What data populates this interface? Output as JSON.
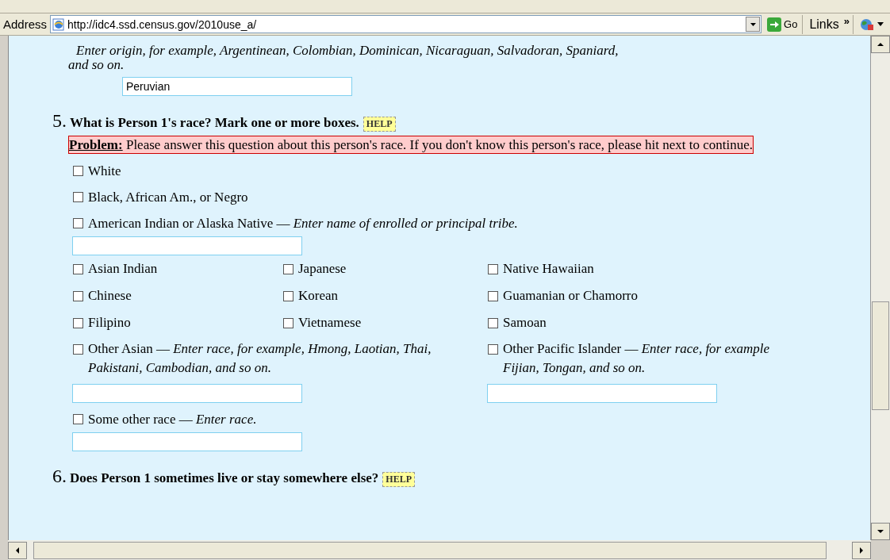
{
  "address_bar": {
    "label": "Address",
    "url": "http://idc4.ssd.census.gov/2010use_a/",
    "go": "Go",
    "links": "Links",
    "links_chevron": "»"
  },
  "origin": {
    "hint": "Enter origin, for example, Argentinean, Colombian, Dominican, Nicaraguan, Salvadoran, Spaniard,",
    "hint_end": "and so on.",
    "value": "Peruvian"
  },
  "question_5": {
    "number": "5.",
    "text": "What is Person 1's race? Mark one or more boxes.",
    "help": "HELP",
    "problem": {
      "label": "Problem:",
      "text": " Please answer this question about this person's race. If you don't know this person's race, please hit next to continue."
    }
  },
  "options": [
    {
      "kind": "plain",
      "label": "White",
      "checked": false
    },
    {
      "kind": "plain",
      "label": "Black, African Am., or Negro",
      "checked": false
    },
    {
      "kind": "write_in",
      "label": "American Indian or Alaska Native — *Enter name of enrolled or principal tribe.*",
      "checked": false
    }
  ],
  "grid": [
    {
      "label": "Asian Indian",
      "checked": false
    },
    {
      "label": "Japanese",
      "checked": false
    },
    {
      "label": "Native Hawaiian",
      "checked": false
    },
    {
      "label": "Chinese",
      "checked": false
    },
    {
      "label": "Korean",
      "checked": false
    },
    {
      "label": "Guamanian or Chamorro",
      "checked": false
    },
    {
      "label": "Filipino",
      "checked": false
    },
    {
      "label": "Vietnamese",
      "checked": false
    },
    {
      "label": "Samoan",
      "checked": false
    }
  ],
  "write_ins": [
    {
      "label": "Other Asian — *Enter race, for example, Hmong, Laotian, Thai, Pakistani, Cambodian, and so on.*",
      "checked": false
    },
    {
      "label": "Other Pacific Islander — *Enter race, for example Fijian, Tongan, and so on.*",
      "checked": false
    }
  ],
  "other": {
    "label": "Some other race — *Enter race.*",
    "checked": false
  },
  "question_6": {
    "number": "6.",
    "text": "Does Person 1 sometimes live or stay somewhere else?",
    "help": "HELP"
  }
}
